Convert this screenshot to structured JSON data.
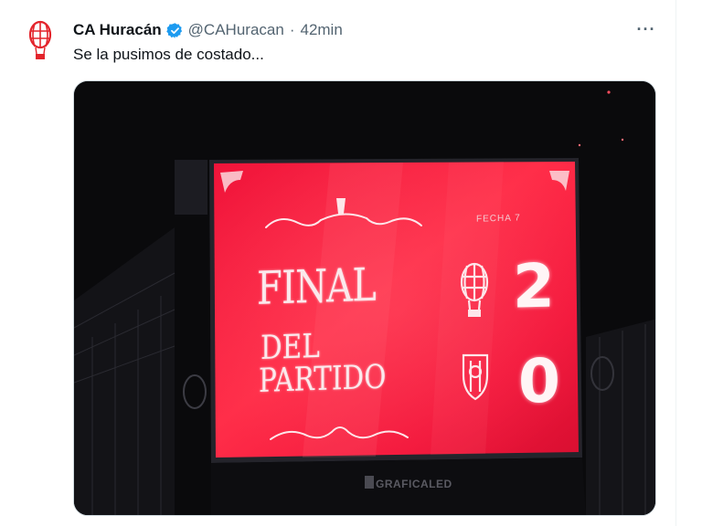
{
  "tweet": {
    "author": {
      "display_name": "CA Huracán",
      "handle": "@CAHuracan",
      "verified_icon": "verified-badge-icon",
      "avatar_icon": "huracan-balloon-crest-icon"
    },
    "separator": "·",
    "timestamp": "42min",
    "more_icon_label": "···",
    "text": "Se la pusimos de costado..."
  },
  "scoreboard": {
    "round_label": "FECHA 7",
    "title_line1": "FINAL",
    "title_line2": "DEL",
    "title_line3": "PARTIDO",
    "home_crest": "huracan-crest-icon",
    "home_score": "2",
    "away_crest": "chacarita-crest-icon",
    "away_score": "0",
    "sponsor": "GRAFICALED"
  },
  "colors": {
    "text_primary": "#0f1419",
    "text_secondary": "#536471",
    "verified_blue": "#1d9bf0",
    "brand_red": "#e3242b",
    "screen_red": "#ee1f3d"
  }
}
